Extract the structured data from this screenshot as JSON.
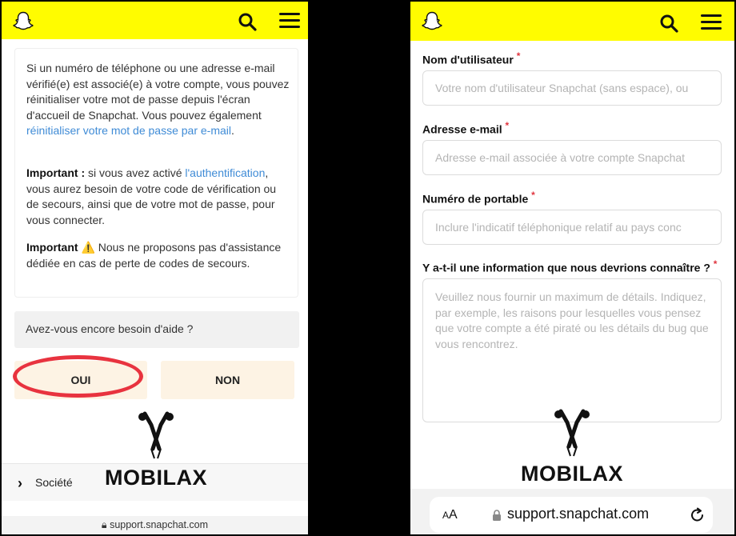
{
  "left": {
    "paragraph1": {
      "text": "Si un numéro de téléphone ou une adresse e-mail vérifié(e) est associé(e) à votre compte, vous pouvez réinitialiser votre mot de passe depuis l'écran d'accueil de Snapchat. Vous pouvez également ",
      "link": "réinitialiser votre mot de passe par e-mail",
      "end": "."
    },
    "paragraph2": {
      "bold": "Important :",
      "text1": " si vous avez activé ",
      "link": "l'authentification",
      "text2": ", vous aurez besoin de votre code de vérification ou de secours, ainsi que de votre mot de passe, pour vous connecter."
    },
    "paragraph3": {
      "bold": "Important",
      "warning_icon": "⚠️",
      "text": " Nous ne proposons pas d'assistance dédiée en cas de perte de codes de secours."
    },
    "help_question": "Avez-vous encore besoin d'aide ?",
    "yes_label": "OUI",
    "no_label": "NON",
    "footer_item": "Société",
    "url": "support.snapchat.com"
  },
  "right": {
    "fields": {
      "username": {
        "label": "Nom d'utilisateur",
        "required": "*",
        "placeholder": "Votre nom d'utilisateur Snapchat (sans espace), ou"
      },
      "email": {
        "label": "Adresse e-mail",
        "required": "*",
        "placeholder": "Adresse e-mail associée à votre compte Snapchat"
      },
      "phone": {
        "label": "Numéro de portable",
        "required": "*",
        "placeholder": "Inclure l'indicatif téléphonique relatif au pays conc"
      },
      "info": {
        "label": "Y a-t-il une information que nous devrions connaître ?",
        "required": "*",
        "placeholder": "Veuillez nous fournir un maximum de détails. Indiquez, par exemple, les raisons pour lesquelles vous pensez que votre compte a été piraté ou les détails du bug que vous rencontrez."
      }
    },
    "safari": {
      "aa_big": "A",
      "aa_small": "A",
      "url": "support.snapchat.com"
    }
  },
  "watermark": "MOBILAX",
  "colors": {
    "brand_yellow": "#FFFC00",
    "link": "#3f8bd6",
    "required": "#e0353f",
    "highlight": "#e8333f",
    "button_bg": "#fdf3e4"
  }
}
